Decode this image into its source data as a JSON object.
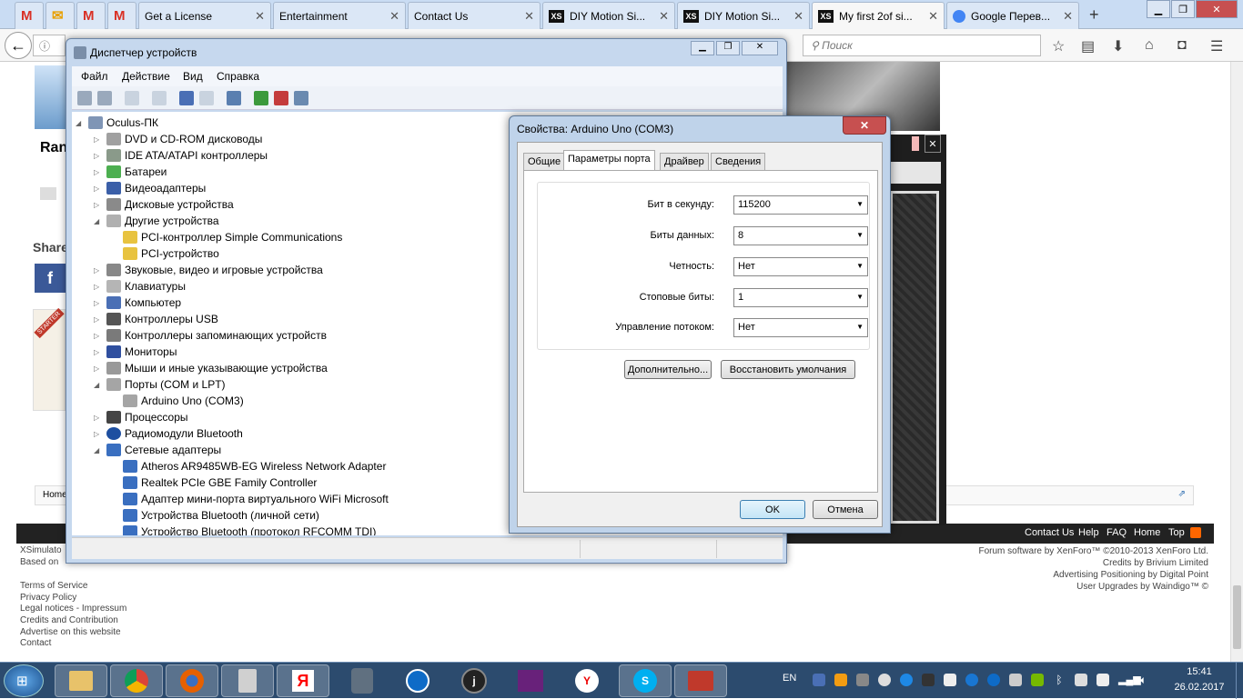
{
  "browser": {
    "tabs": [
      {
        "label": "",
        "icon": "gmail-icon"
      },
      {
        "label": "",
        "icon": "mail-icon"
      },
      {
        "label": "",
        "icon": "gmail-icon"
      },
      {
        "label": "",
        "icon": "gmail-icon"
      },
      {
        "label": "Get a License"
      },
      {
        "label": "Entertainment"
      },
      {
        "label": "Contact Us"
      },
      {
        "label": "DIY Motion Si..."
      },
      {
        "label": "DIY Motion Si..."
      },
      {
        "label": "My first 2of si..."
      },
      {
        "label": "Google Перев..."
      }
    ],
    "search_placeholder": "Поиск"
  },
  "page": {
    "left_heading": "Ran",
    "share_label": "Share",
    "starter": "STARTER",
    "home_breadcrumb": "Home",
    "xsim_text": "XSimulato",
    "based_text": "Based on",
    "footer_dark_links": [
      "Contact Us",
      "Help",
      "FAQ",
      "Home",
      "Top"
    ],
    "footer_right": [
      "Forum software by XenForo™ ©2010-2013 XenForo Ltd.",
      "Credits by Brivium Limited",
      "Advertising Positioning by Digital Point",
      "User Upgrades by Waindigo™ ©"
    ],
    "footer_left": [
      "Terms of Service",
      "Privacy Policy",
      "Legal notices - Impressum",
      "Credits and Contribution",
      "Advertise on this website",
      "Contact"
    ]
  },
  "device_manager": {
    "title": "Диспетчер устройств",
    "menu": [
      "Файл",
      "Действие",
      "Вид",
      "Справка"
    ],
    "root": "Oculus-ПК",
    "items": [
      {
        "label": "DVD и CD-ROM дисководы",
        "level": 1
      },
      {
        "label": "IDE ATA/ATAPI контроллеры",
        "level": 1
      },
      {
        "label": "Батареи",
        "level": 1
      },
      {
        "label": "Видеоадаптеры",
        "level": 1
      },
      {
        "label": "Дисковые устройства",
        "level": 1
      },
      {
        "label": "Другие устройства",
        "level": 1,
        "expanded": true
      },
      {
        "label": "PCI-контроллер Simple Communications",
        "level": 2
      },
      {
        "label": "PCI-устройство",
        "level": 2
      },
      {
        "label": "Звуковые, видео и игровые устройства",
        "level": 1
      },
      {
        "label": "Клавиатуры",
        "level": 1
      },
      {
        "label": "Компьютер",
        "level": 1
      },
      {
        "label": "Контроллеры USB",
        "level": 1
      },
      {
        "label": "Контроллеры запоминающих устройств",
        "level": 1
      },
      {
        "label": "Мониторы",
        "level": 1
      },
      {
        "label": "Мыши и иные указывающие устройства",
        "level": 1
      },
      {
        "label": "Порты (COM и LPT)",
        "level": 1,
        "expanded": true
      },
      {
        "label": "Arduino Uno (COM3)",
        "level": 2
      },
      {
        "label": "Процессоры",
        "level": 1
      },
      {
        "label": "Радиомодули Bluetooth",
        "level": 1
      },
      {
        "label": "Сетевые адаптеры",
        "level": 1,
        "expanded": true
      },
      {
        "label": "Atheros AR9485WB-EG Wireless Network Adapter",
        "level": 2
      },
      {
        "label": "Realtek PCIe GBE Family Controller",
        "level": 2
      },
      {
        "label": "Адаптер мини-порта виртуального WiFi Microsoft",
        "level": 2
      },
      {
        "label": "Устройства Bluetooth (личной сети)",
        "level": 2
      },
      {
        "label": "Устройство Bluetooth (протокол RFCOMM TDI)",
        "level": 2
      }
    ]
  },
  "properties": {
    "title": "Свойства: Arduino Uno (COM3)",
    "tabs": [
      "Общие",
      "Параметры порта",
      "Драйвер",
      "Сведения"
    ],
    "fields": [
      {
        "label": "Бит в секунду:",
        "value": "115200"
      },
      {
        "label": "Биты данных:",
        "value": "8"
      },
      {
        "label": "Четность:",
        "value": "Нет"
      },
      {
        "label": "Стоповые биты:",
        "value": "1"
      },
      {
        "label": "Управление потоком:",
        "value": "Нет"
      }
    ],
    "advanced_btn": "Дополнительно...",
    "restore_btn": "Восстановить умолчания",
    "ok": "OK",
    "cancel": "Отмена"
  },
  "taskbar": {
    "lang": "EN",
    "time": "15:41",
    "date": "26.02.2017"
  }
}
